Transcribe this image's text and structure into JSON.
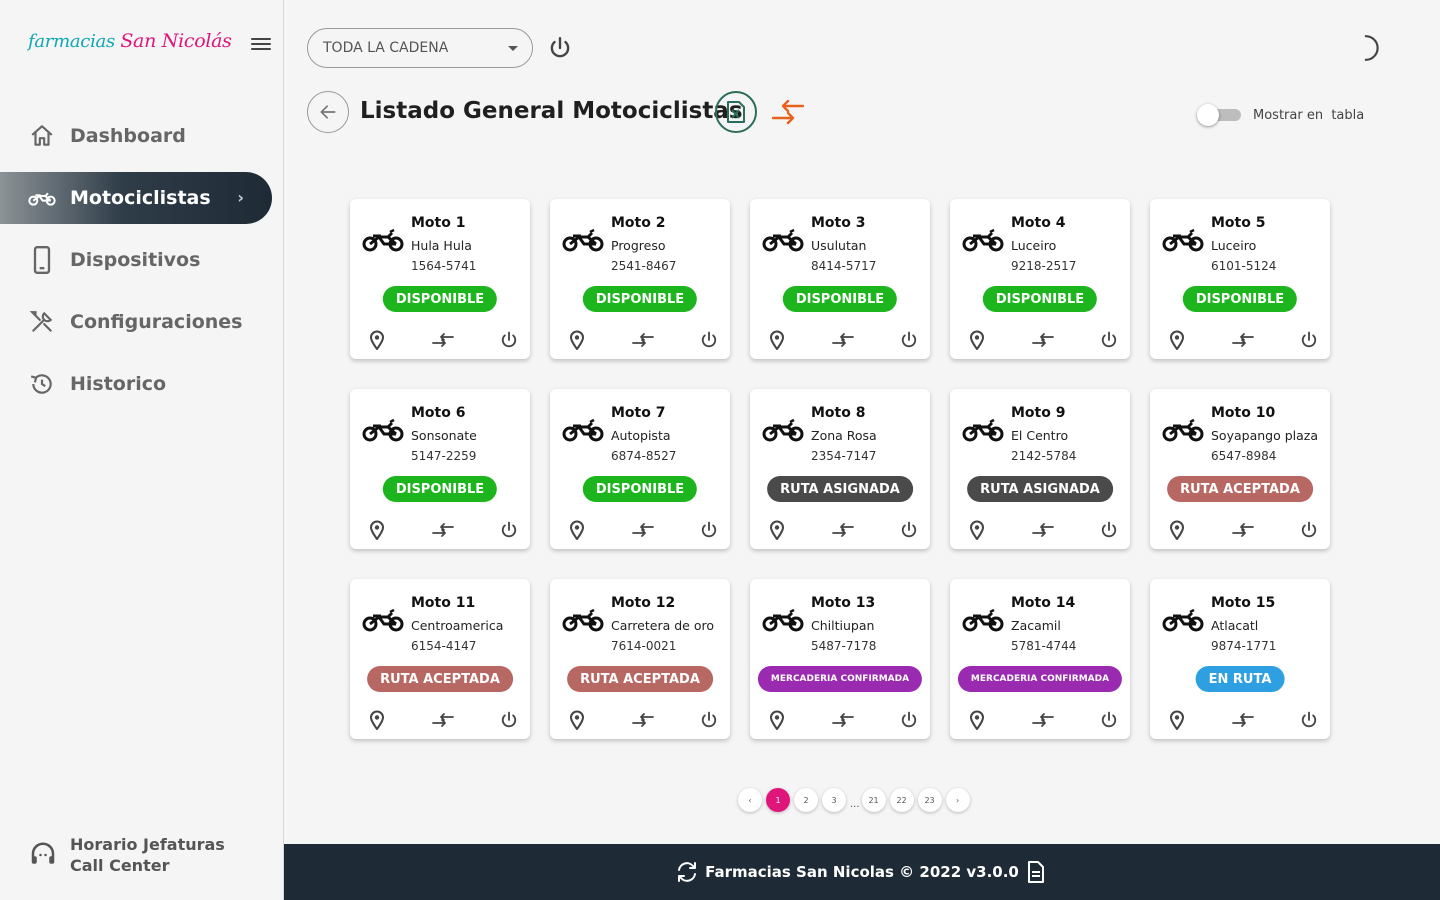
{
  "sidebar": {
    "logo": {
      "part1": "farmacias ",
      "part2": "San Nicolás"
    },
    "items": [
      {
        "label": "Dashboard",
        "icon": "home-icon"
      },
      {
        "label": "Motociclistas",
        "icon": "motorcycle-icon",
        "active": true
      },
      {
        "label": "Dispositivos",
        "icon": "phone-icon"
      },
      {
        "label": "Configuraciones",
        "icon": "tools-icon"
      },
      {
        "label": "Historico",
        "icon": "history-icon"
      }
    ],
    "footer": {
      "line1": "Horario Jefaturas",
      "line2": "Call Center",
      "icon": "support-agent-icon"
    }
  },
  "header": {
    "select_value": "TODA LA CADENA",
    "page_title": "Listado General Motociclistas",
    "toggle_label": "Mostrar en  tabla"
  },
  "cards": [
    {
      "name": "Moto 1",
      "location": "Hula Hula",
      "phone": "1564-5741",
      "status": "DISPONIBLE",
      "status_type": "disponible"
    },
    {
      "name": "Moto 2",
      "location": "Progreso",
      "phone": "2541-8467",
      "status": "DISPONIBLE",
      "status_type": "disponible"
    },
    {
      "name": "Moto 3",
      "location": "Usulutan",
      "phone": "8414-5717",
      "status": "DISPONIBLE",
      "status_type": "disponible"
    },
    {
      "name": "Moto 4",
      "location": "Luceiro",
      "phone": "9218-2517",
      "status": "DISPONIBLE",
      "status_type": "disponible"
    },
    {
      "name": "Moto 5",
      "location": "Luceiro",
      "phone": "6101-5124",
      "status": "DISPONIBLE",
      "status_type": "disponible"
    },
    {
      "name": "Moto 6",
      "location": "Sonsonate",
      "phone": "5147-2259",
      "status": "DISPONIBLE",
      "status_type": "disponible"
    },
    {
      "name": "Moto 7",
      "location": "Autopista",
      "phone": "6874-8527",
      "status": "DISPONIBLE",
      "status_type": "disponible"
    },
    {
      "name": "Moto 8",
      "location": "Zona Rosa",
      "phone": "2354-7147",
      "status": "RUTA ASIGNADA",
      "status_type": "asignada"
    },
    {
      "name": "Moto 9",
      "location": "El Centro",
      "phone": "2142-5784",
      "status": "RUTA ASIGNADA",
      "status_type": "asignada"
    },
    {
      "name": "Moto 10",
      "location": "Soyapango plaza",
      "phone": "6547-8984",
      "status": "RUTA ACEPTADA",
      "status_type": "aceptada"
    },
    {
      "name": "Moto 11",
      "location": "Centroamerica",
      "phone": "6154-4147",
      "status": "RUTA ACEPTADA",
      "status_type": "aceptada"
    },
    {
      "name": "Moto 12",
      "location": "Carretera de oro",
      "phone": "7614-0021",
      "status": "RUTA ACEPTADA",
      "status_type": "aceptada"
    },
    {
      "name": "Moto 13",
      "location": "Chiltiupan",
      "phone": "5487-7178",
      "status": "MERCADERIA CONFIRMADA",
      "status_type": "mercaderia"
    },
    {
      "name": "Moto 14",
      "location": "Zacamil",
      "phone": "5781-4744",
      "status": "MERCADERIA CONFIRMADA",
      "status_type": "mercaderia"
    },
    {
      "name": "Moto 15",
      "location": "Atlacatl",
      "phone": "9874-1771",
      "status": "EN RUTA",
      "status_type": "enruta"
    }
  ],
  "status_colors": {
    "disponible": "#1db51d",
    "asignada": "#4a4a4a",
    "aceptada": "#b86863",
    "mercaderia": "#9a2bb0",
    "enruta": "#2e9fe0"
  },
  "pagination": {
    "prev": "‹",
    "pages": [
      "1",
      "2",
      "3"
    ],
    "ellipsis": "...",
    "last_pages": [
      "21",
      "22",
      "23"
    ],
    "next": "›",
    "current": "1"
  },
  "footer": {
    "text": "Farmacias San Nicolas © 2022 v3.0.0"
  }
}
